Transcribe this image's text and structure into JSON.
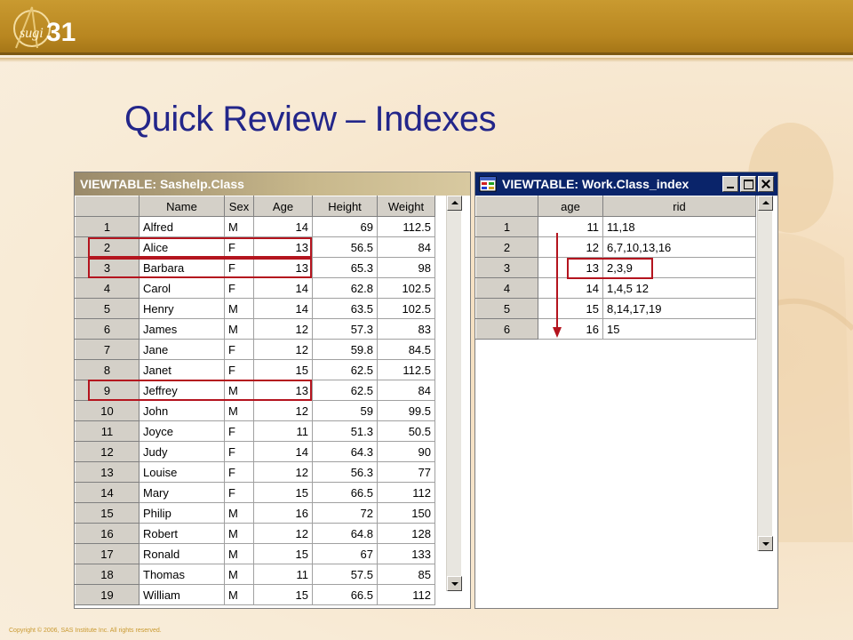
{
  "slide": {
    "title": "Quick Review – Indexes",
    "copyright": "Copyright © 2006, SAS Institute Inc. All rights reserved.",
    "logo_text": "sugi 31"
  },
  "window_class": {
    "title": "VIEWTABLE: Sashelp.Class",
    "columns": [
      "Name",
      "Sex",
      "Age",
      "Height",
      "Weight"
    ],
    "rows": [
      {
        "n": "1",
        "name": "Alfred",
        "sex": "M",
        "age": "14",
        "height": "69",
        "weight": "112.5"
      },
      {
        "n": "2",
        "name": "Alice",
        "sex": "F",
        "age": "13",
        "height": "56.5",
        "weight": "84"
      },
      {
        "n": "3",
        "name": "Barbara",
        "sex": "F",
        "age": "13",
        "height": "65.3",
        "weight": "98"
      },
      {
        "n": "4",
        "name": "Carol",
        "sex": "F",
        "age": "14",
        "height": "62.8",
        "weight": "102.5"
      },
      {
        "n": "5",
        "name": "Henry",
        "sex": "M",
        "age": "14",
        "height": "63.5",
        "weight": "102.5"
      },
      {
        "n": "6",
        "name": "James",
        "sex": "M",
        "age": "12",
        "height": "57.3",
        "weight": "83"
      },
      {
        "n": "7",
        "name": "Jane",
        "sex": "F",
        "age": "12",
        "height": "59.8",
        "weight": "84.5"
      },
      {
        "n": "8",
        "name": "Janet",
        "sex": "F",
        "age": "15",
        "height": "62.5",
        "weight": "112.5"
      },
      {
        "n": "9",
        "name": "Jeffrey",
        "sex": "M",
        "age": "13",
        "height": "62.5",
        "weight": "84"
      },
      {
        "n": "10",
        "name": "John",
        "sex": "M",
        "age": "12",
        "height": "59",
        "weight": "99.5"
      },
      {
        "n": "11",
        "name": "Joyce",
        "sex": "F",
        "age": "11",
        "height": "51.3",
        "weight": "50.5"
      },
      {
        "n": "12",
        "name": "Judy",
        "sex": "F",
        "age": "14",
        "height": "64.3",
        "weight": "90"
      },
      {
        "n": "13",
        "name": "Louise",
        "sex": "F",
        "age": "12",
        "height": "56.3",
        "weight": "77"
      },
      {
        "n": "14",
        "name": "Mary",
        "sex": "F",
        "age": "15",
        "height": "66.5",
        "weight": "112"
      },
      {
        "n": "15",
        "name": "Philip",
        "sex": "M",
        "age": "16",
        "height": "72",
        "weight": "150"
      },
      {
        "n": "16",
        "name": "Robert",
        "sex": "M",
        "age": "12",
        "height": "64.8",
        "weight": "128"
      },
      {
        "n": "17",
        "name": "Ronald",
        "sex": "M",
        "age": "15",
        "height": "67",
        "weight": "133"
      },
      {
        "n": "18",
        "name": "Thomas",
        "sex": "M",
        "age": "11",
        "height": "57.5",
        "weight": "85"
      },
      {
        "n": "19",
        "name": "William",
        "sex": "M",
        "age": "15",
        "height": "66.5",
        "weight": "112"
      }
    ]
  },
  "window_index": {
    "title": "VIEWTABLE: Work.Class_index",
    "columns": [
      "age",
      "rid"
    ],
    "rows": [
      {
        "n": "1",
        "age": "11",
        "rid": "11,18"
      },
      {
        "n": "2",
        "age": "12",
        "rid": "6,7,10,13,16"
      },
      {
        "n": "3",
        "age": "13",
        "rid": "2,3,9"
      },
      {
        "n": "4",
        "age": "14",
        "rid": "1,4,5 12"
      },
      {
        "n": "5",
        "age": "15",
        "rid": "8,14,17,19"
      },
      {
        "n": "6",
        "age": "16",
        "rid": "15"
      }
    ]
  },
  "colors": {
    "title": "#23268a",
    "highlight": "#b4141e",
    "banner": "#b88620"
  }
}
